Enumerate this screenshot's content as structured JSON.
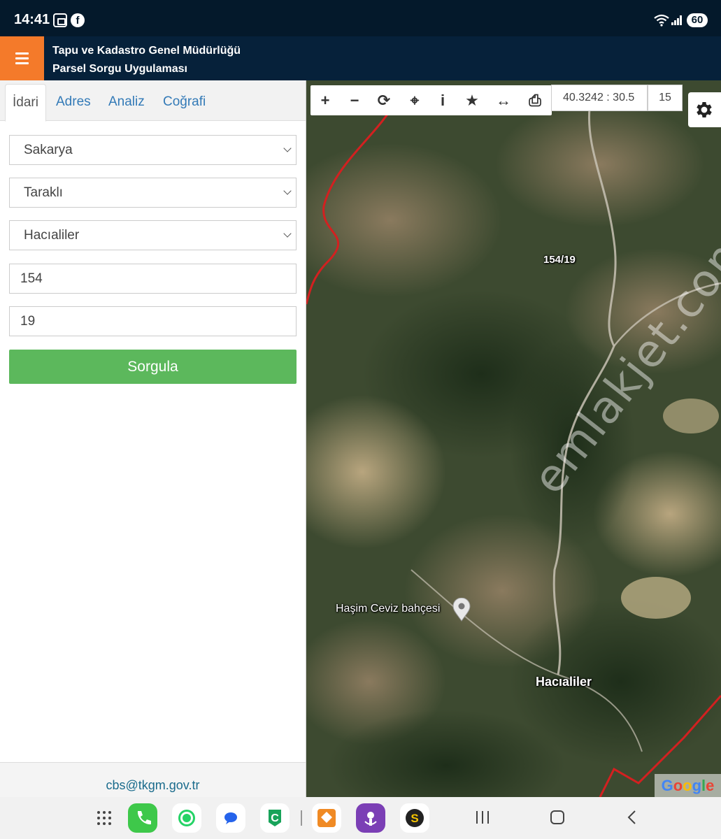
{
  "status_bar": {
    "time": "14:41",
    "battery": "60",
    "icons": [
      "screenshot-icon",
      "facebook-icon",
      "wifi-icon",
      "signal-icon",
      "battery-icon"
    ]
  },
  "header": {
    "title_line1": "Tapu ve Kadastro Genel Müdürlüğü",
    "title_line2": "Parsel Sorgu Uygulaması",
    "accent_color": "#f47a2a",
    "bg_color": "#06213a"
  },
  "tabs": [
    {
      "label": "İdari",
      "active": true
    },
    {
      "label": "Adres",
      "active": false
    },
    {
      "label": "Analiz",
      "active": false
    },
    {
      "label": "Coğrafi",
      "active": false
    }
  ],
  "form": {
    "province": "Sakarya",
    "district": "Taraklı",
    "neighborhood": "Hacıaliler",
    "block": "154",
    "parcel": "19",
    "submit_label": "Sorgula",
    "submit_color": "#5cb85c"
  },
  "footer": {
    "email": "cbs@tkgm.gov.tr"
  },
  "map": {
    "toolbar": [
      "zoom-in-icon",
      "zoom-out-icon",
      "refresh-icon",
      "locate-icon",
      "info-icon",
      "favorite-icon",
      "measure-icon",
      "print-icon"
    ],
    "coordinates": "40.3242 : 30.5",
    "zoom": "15",
    "parcel_label": "154/19",
    "poi_label": "Haşim Ceviz bahçesi",
    "village_label": "Hacıaliler",
    "attribution": "Google",
    "watermark": "emlakjet.com"
  },
  "nav_bar": {
    "apps": [
      "apps-grid-icon",
      "phone-icon",
      "whatsapp-icon",
      "messages-icon",
      "c-app-icon",
      "sahibinden-icon",
      "flower-app-icon",
      "s-app-icon"
    ],
    "buttons": [
      "recents-icon",
      "home-icon",
      "back-icon"
    ]
  }
}
